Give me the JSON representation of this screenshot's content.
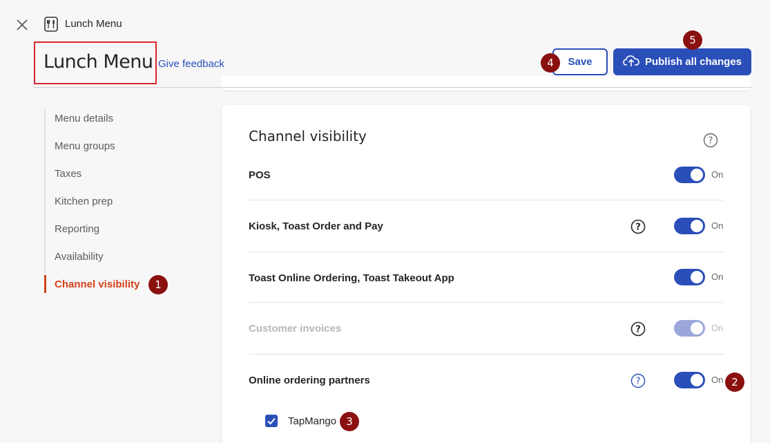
{
  "top_bar": {
    "close_icon": "close-x-icon",
    "crumb_icon": "menu-utensils-icon",
    "crumb_title": "Lunch Menu"
  },
  "header": {
    "title": "Lunch Menu",
    "feedback_link": "Give feedback",
    "save_label": "Save",
    "publish_label": "Publish all changes",
    "publish_icon": "cloud-upload-icon"
  },
  "side_nav": {
    "items": [
      {
        "label": "Menu details",
        "active": false
      },
      {
        "label": "Menu groups",
        "active": false
      },
      {
        "label": "Taxes",
        "active": false
      },
      {
        "label": "Kitchen prep",
        "active": false
      },
      {
        "label": "Reporting",
        "active": false
      },
      {
        "label": "Availability",
        "active": false
      },
      {
        "label": "Channel visibility",
        "active": true
      }
    ]
  },
  "card": {
    "title": "Channel visibility",
    "rows": [
      {
        "label": "POS",
        "has_help": false,
        "toggle": "On",
        "enabled": true
      },
      {
        "label": "Kiosk, Toast Order and Pay",
        "has_help": true,
        "toggle": "On",
        "enabled": true
      },
      {
        "label": "Toast Online Ordering, Toast Takeout App",
        "has_help": false,
        "toggle": "On",
        "enabled": true
      },
      {
        "label": "Customer invoices",
        "has_help": true,
        "toggle": "On",
        "enabled": false
      },
      {
        "label": "Online ordering partners",
        "has_help": true,
        "toggle": "On",
        "enabled": true
      }
    ],
    "partner_checkbox": {
      "label": "TapMango",
      "checked": true
    }
  },
  "callouts": [
    "1",
    "2",
    "3",
    "4",
    "5"
  ],
  "colors": {
    "primary": "#2b4fb9",
    "active_nav": "#d4421c",
    "callout": "#8b1010",
    "highlight_box": "#d9262c"
  }
}
